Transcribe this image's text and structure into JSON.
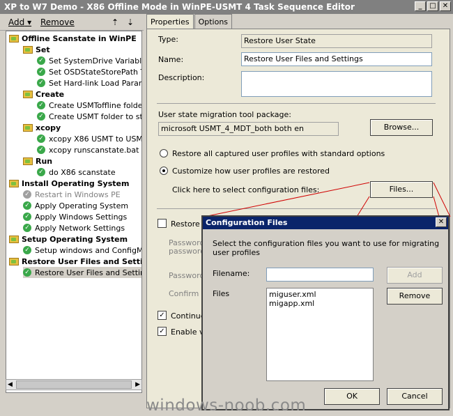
{
  "window": {
    "title": "XP to W7 Demo - X86 Offline Mode in WinPE-USMT 4 Task Sequence Editor"
  },
  "toolbar": {
    "add_label": "Add",
    "remove_label": "Remove"
  },
  "tree": {
    "items": [
      {
        "label": "Offline Scanstate in WinPE"
      },
      {
        "label": "Set"
      },
      {
        "label": "Set SystemDrive Variable"
      },
      {
        "label": "Set OSDStateStorePath Ta"
      },
      {
        "label": "Set Hard-link Load Paramet"
      },
      {
        "label": "Create"
      },
      {
        "label": "Create USMToffline folder"
      },
      {
        "label": "Create USMT folder to stor"
      },
      {
        "label": "xcopy"
      },
      {
        "label": "xcopy X86 USMT to USMTb"
      },
      {
        "label": "xcopy runscanstate.bat to"
      },
      {
        "label": "Run"
      },
      {
        "label": "do X86 scanstate"
      },
      {
        "label": "Install Operating System"
      },
      {
        "label": "Restart in Windows PE"
      },
      {
        "label": "Apply Operating System"
      },
      {
        "label": "Apply Windows Settings"
      },
      {
        "label": "Apply Network Settings"
      },
      {
        "label": "Setup Operating System"
      },
      {
        "label": "Setup windows and ConfigMgr"
      },
      {
        "label": "Restore User Files and Setting"
      },
      {
        "label": "Restore User Files and Settings"
      }
    ]
  },
  "tabs": {
    "properties": "Properties",
    "options": "Options"
  },
  "properties": {
    "type_label": "Type:",
    "type_value": "Restore User State",
    "name_label": "Name:",
    "name_value": "Restore User Files and Settings",
    "description_label": "Description:",
    "description_value": "",
    "package_label": "User state migration tool package:",
    "package_value": "microsoft USMT_4_MDT_both both en",
    "browse_label": "Browse...",
    "radio_all_label": "Restore all captured user profiles with standard options",
    "radio_custom_label": "Customize how user profiles are restored",
    "config_files_label": "Click here to select configuration files:",
    "files_button_label": "Files...",
    "restore_local_label": "Restore l",
    "password_label": "Password",
    "password_label2": "password",
    "password_label3": "Password",
    "confirm_label": "Confirm P",
    "continue_label": "Continue",
    "enable_label": "Enable ve"
  },
  "dialog": {
    "title": "Configuration Files",
    "instruction": "Select the configuration files you want to use for migrating user profiles",
    "filename_label": "Filename:",
    "filename_value": "",
    "add_label": "Add",
    "files_label": "Files",
    "files": [
      "miguser.xml",
      "migapp.xml"
    ],
    "remove_label": "Remove",
    "ok_label": "OK",
    "cancel_label": "Cancel"
  },
  "watermark": "windows-noob.com",
  "colors": {
    "dialog_title_bg": "#0a246a",
    "check_green": "#3aa84a",
    "annotation_red": "#d00000"
  }
}
